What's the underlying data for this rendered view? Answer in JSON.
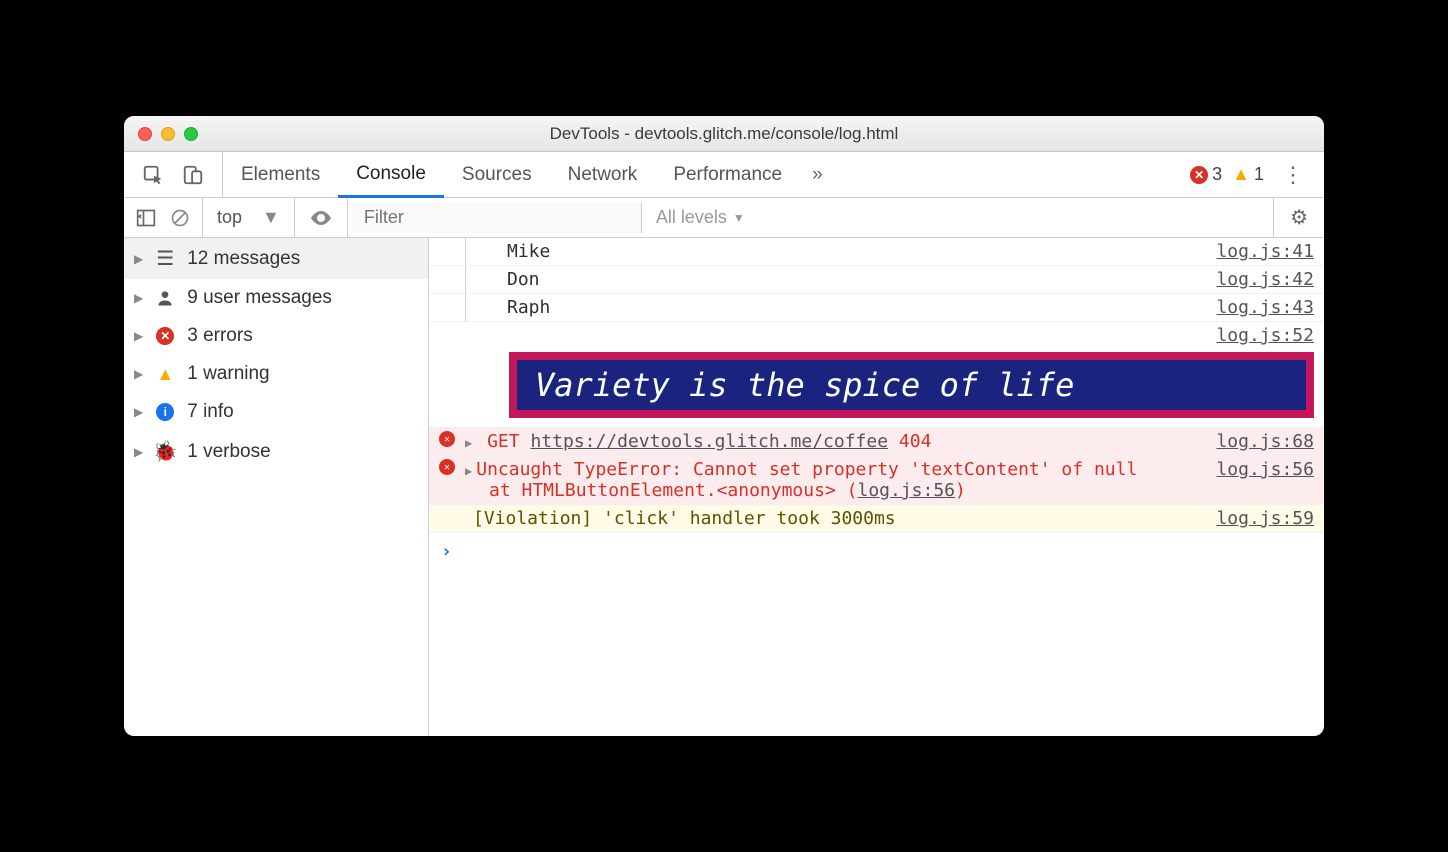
{
  "window": {
    "title": "DevTools - devtools.glitch.me/console/log.html"
  },
  "tabs": {
    "items": [
      "Elements",
      "Console",
      "Sources",
      "Network",
      "Performance"
    ],
    "active_index": 1,
    "more_glyph": "»"
  },
  "badges": {
    "errors": "3",
    "warnings": "1"
  },
  "console_toolbar": {
    "context": "top",
    "filter_placeholder": "Filter",
    "levels_label": "All levels"
  },
  "sidebar": {
    "items": [
      {
        "icon": "list",
        "label": "12 messages",
        "selected": true
      },
      {
        "icon": "user",
        "label": "9 user messages",
        "selected": false
      },
      {
        "icon": "error",
        "label": "3 errors",
        "selected": false
      },
      {
        "icon": "warning",
        "label": "1 warning",
        "selected": false
      },
      {
        "icon": "info",
        "label": "7 info",
        "selected": false
      },
      {
        "icon": "bug",
        "label": "1 verbose",
        "selected": false
      }
    ]
  },
  "messages": {
    "plain": [
      {
        "text": "Mike",
        "src": "log.js:41"
      },
      {
        "text": "Don",
        "src": "log.js:42"
      },
      {
        "text": "Raph",
        "src": "log.js:43"
      }
    ],
    "styled": {
      "text": "Variety is the spice of life",
      "src": "log.js:52"
    },
    "fetch": {
      "method": "GET",
      "url": "https://devtools.glitch.me/coffee",
      "status": "404",
      "src": "log.js:68"
    },
    "exception": {
      "head": "Uncaught TypeError: Cannot set property 'textContent' of null",
      "stack_prefix": "at HTMLButtonElement.",
      "stack_anon": "<anonymous>",
      "stack_loc": "log.js:56",
      "src": "log.js:56"
    },
    "violation": {
      "text": "[Violation] 'click' handler took 3000ms",
      "src": "log.js:59"
    },
    "prompt": "›"
  }
}
